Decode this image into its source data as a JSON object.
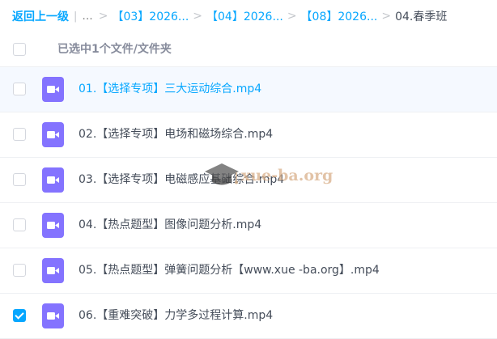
{
  "breadcrumb": {
    "back_label": "返回上一级",
    "ellipsis": "...",
    "items": [
      "【03】2026...",
      "【04】2026...",
      "【08】2026..."
    ],
    "current": "04.春季班"
  },
  "selection": {
    "text": "已选中1个文件/文件夹"
  },
  "files": [
    {
      "name": "01.【选择专项】三大运动综合.mp4",
      "checked": false,
      "highlight": true
    },
    {
      "name": "02.【选择专项】电场和磁场综合.mp4",
      "checked": false,
      "highlight": false
    },
    {
      "name": "03.【选择专项】电磁感应基础综合.mp4",
      "checked": false,
      "highlight": false
    },
    {
      "name": "04.【热点题型】图像问题分析.mp4",
      "checked": false,
      "highlight": false
    },
    {
      "name": "05.【热点题型】弹簧问题分析【www.xue -ba.org】.mp4",
      "checked": false,
      "highlight": false
    },
    {
      "name": "06.【重难突破】力学多过程计算.mp4",
      "checked": true,
      "highlight": false
    }
  ],
  "watermark": {
    "text": "xue-ba.org"
  },
  "icons": {
    "file_icon": "video-file-icon",
    "watermark_icon": "graduation-cap-icon"
  },
  "colors": {
    "accent": "#06a7ff",
    "video_icon": "#8473ff",
    "highlight_row": "#f5f9ff",
    "text": "#454d5a",
    "muted_text": "#878c9c"
  }
}
